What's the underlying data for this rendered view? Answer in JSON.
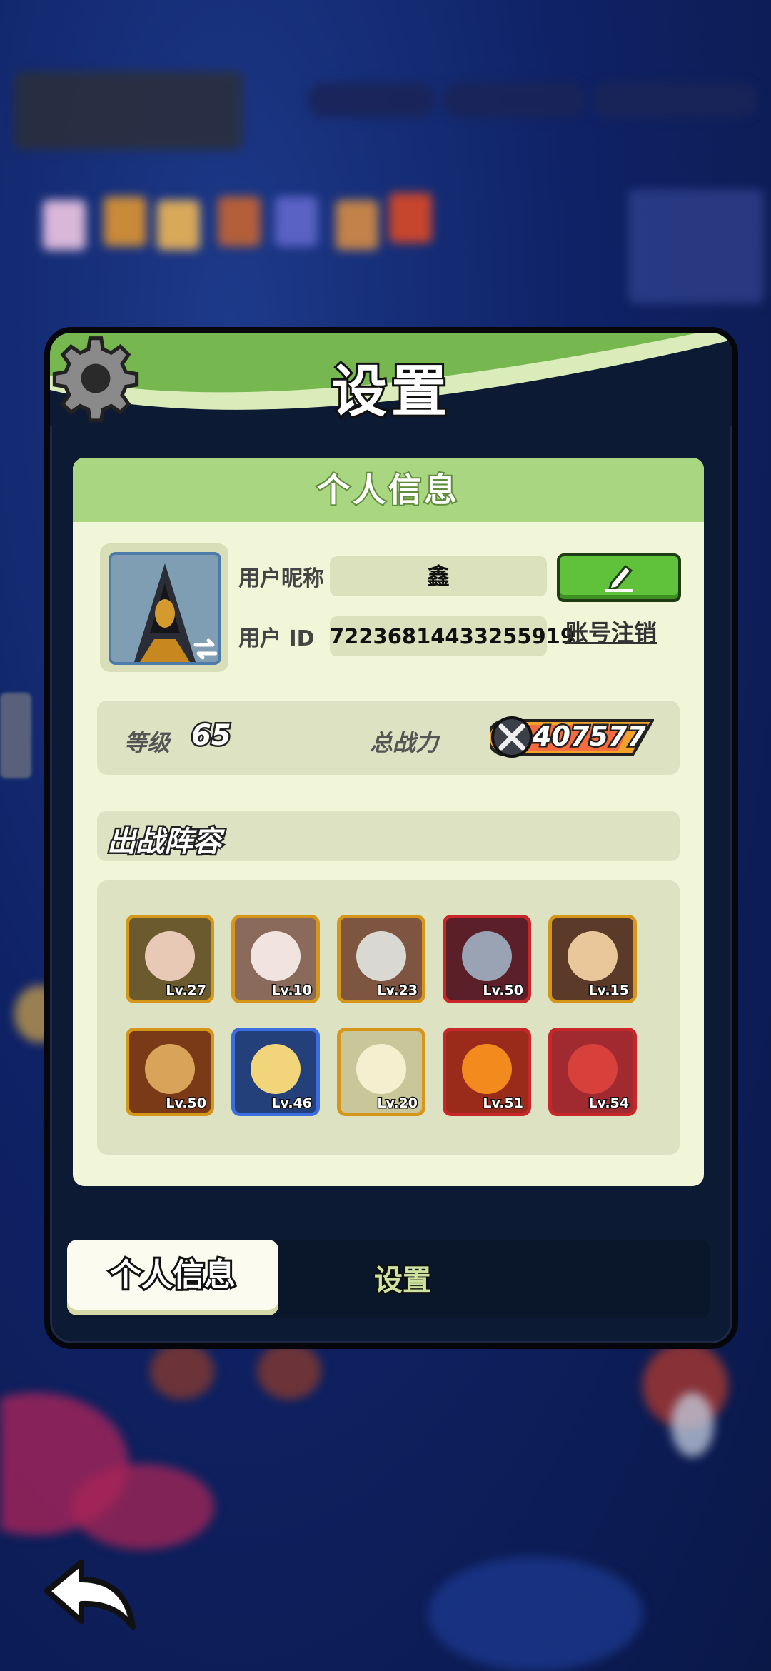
{
  "dialog": {
    "title": "设置"
  },
  "panel": {
    "header": "个人信息"
  },
  "profile": {
    "nickname_label": "用户昵称",
    "nickname_value": "鑫",
    "id_label": "用户  ID",
    "id_value": "72236814433255919",
    "cancel_account": "账号注销"
  },
  "stats": {
    "level_label": "等级",
    "level_value": "65",
    "power_label": "总战力",
    "power_value": "407577"
  },
  "lineup": {
    "title": "出战阵容",
    "heroes": [
      {
        "level": "Lv.27"
      },
      {
        "level": "Lv.10"
      },
      {
        "level": "Lv.23"
      },
      {
        "level": "Lv.50"
      },
      {
        "level": "Lv.15"
      },
      {
        "level": "Lv.50"
      },
      {
        "level": "Lv.46"
      },
      {
        "level": "Lv.20"
      },
      {
        "level": "Lv.51"
      },
      {
        "level": "Lv.54"
      }
    ]
  },
  "tabs": {
    "active": "个人信息",
    "inactive": "设置"
  },
  "colors": {
    "header_green": "#76b84f",
    "panel_bg": "#f0f6d7",
    "frame_gold": "#d69619",
    "frame_red": "#c9262a",
    "frame_blue": "#3a6ee0",
    "edit_green": "#5fc23a"
  },
  "icons": [
    "gear-icon",
    "edit-pencil-icon",
    "swap-arrows-icon",
    "sword-power-icon",
    "back-arrow-icon"
  ]
}
